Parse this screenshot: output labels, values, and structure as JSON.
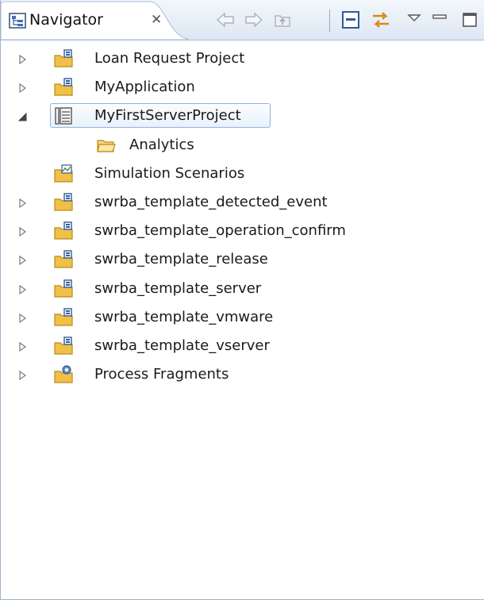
{
  "view": {
    "title": "Navigator",
    "close_glyph": "✕",
    "toolbar": {
      "buttons": [
        {
          "name": "back-button",
          "icon": "back-arrow-icon"
        },
        {
          "name": "forward-button",
          "icon": "forward-arrow-icon"
        },
        {
          "name": "up-button",
          "icon": "up-folder-icon"
        },
        {
          "name": "collapse-all-button",
          "icon": "collapse-all-icon"
        },
        {
          "name": "link-with-editor-button",
          "icon": "link-with-editor-icon"
        },
        {
          "name": "view-menu-button",
          "icon": "view-menu-icon"
        },
        {
          "name": "minimize-button",
          "icon": "minimize-icon"
        },
        {
          "name": "maximize-button",
          "icon": "maximize-icon"
        }
      ]
    }
  },
  "tree": {
    "items": [
      {
        "label": "Loan Request Project",
        "icon": "project-folder-icon",
        "expander": "collapsed"
      },
      {
        "label": "MyApplication",
        "icon": "project-folder-icon",
        "expander": "collapsed"
      },
      {
        "label": "MyFirstServerProject",
        "icon": "server-project-icon",
        "expander": "expanded",
        "selected": true
      },
      {
        "label": "Analytics",
        "icon": "folder-icon",
        "expander": "none",
        "indent": 1
      },
      {
        "label": "Simulation Scenarios",
        "icon": "simulation-folder-icon",
        "expander": "none"
      },
      {
        "label": "swrba_template_detected_event",
        "icon": "project-folder-icon",
        "expander": "collapsed"
      },
      {
        "label": "swrba_template_operation_confirm",
        "icon": "project-folder-icon",
        "expander": "collapsed"
      },
      {
        "label": "swrba_template_release",
        "icon": "project-folder-icon",
        "expander": "collapsed"
      },
      {
        "label": "swrba_template_server",
        "icon": "project-folder-icon",
        "expander": "collapsed"
      },
      {
        "label": "swrba_template_vmware",
        "icon": "project-folder-icon",
        "expander": "collapsed"
      },
      {
        "label": "swrba_template_vserver",
        "icon": "project-folder-icon",
        "expander": "collapsed"
      },
      {
        "label": "Process Fragments",
        "icon": "process-fragments-icon",
        "expander": "collapsed"
      }
    ]
  },
  "colors": {
    "accent": "#3d6fb6",
    "folder": "#f0c048",
    "selection_border": "#8fb4dd",
    "tab_bar": "#dde7f3"
  }
}
